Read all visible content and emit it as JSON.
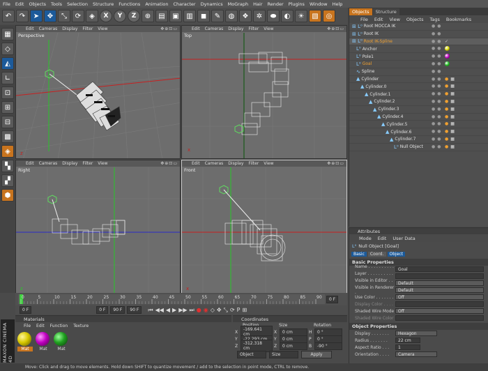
{
  "menubar": [
    "File",
    "Edit",
    "Objects",
    "Tools",
    "Selection",
    "Structure",
    "Functions",
    "Animation",
    "Character",
    "Dynamics",
    "MoGraph",
    "Hair",
    "Render",
    "Plugins",
    "Window",
    "Help"
  ],
  "toolbar": {
    "axis": [
      "X",
      "Y",
      "Z"
    ]
  },
  "viewport_menu": [
    "Edit",
    "Cameras",
    "Display",
    "Filter",
    "View"
  ],
  "viewports": {
    "perspective": "Perspective",
    "top": "Top",
    "right": "Right",
    "front": "Front"
  },
  "timeline": {
    "ticks": [
      "0",
      "5",
      "10",
      "15",
      "20",
      "25",
      "30",
      "35",
      "40",
      "45",
      "50",
      "55",
      "60",
      "65",
      "70",
      "75",
      "80",
      "85",
      "90"
    ],
    "end_field": "0 F"
  },
  "transport": {
    "start": "0 F",
    "mid": "0 F",
    "end": "90 F",
    "end2": "90 F"
  },
  "materials": {
    "title": "Materials",
    "menu": [
      "File",
      "Edit",
      "Function",
      "Texture"
    ],
    "items": [
      {
        "label": "Mat",
        "color": "#d8c800"
      },
      {
        "label": "Mat",
        "color": "#c000c0"
      },
      {
        "label": "Mat",
        "color": "#20a020"
      }
    ]
  },
  "coordinates": {
    "title": "Coordinates",
    "headers": [
      "Position",
      "Size",
      "Rotation"
    ],
    "rows": [
      {
        "axis": "X",
        "pos": "-169.641 cm",
        "saxis": "X",
        "size": "0 cm",
        "raxis": "H",
        "rot": "0 °"
      },
      {
        "axis": "Y",
        "pos": "-22.293 cm",
        "saxis": "Y",
        "size": "0 cm",
        "raxis": "P",
        "rot": "0 °"
      },
      {
        "axis": "Z",
        "pos": "-312.318 cm",
        "saxis": "Z",
        "size": "0 cm",
        "raxis": "B",
        "rot": "-90 °"
      }
    ],
    "mode1": "Object",
    "mode2": "Size",
    "apply": "Apply"
  },
  "status": "Move: Click and drag to move elements. Hold down SHIFT to quantize movement / add to the selection in point mode, CTRL to remove.",
  "brand": "MAXON CINEMA 4D",
  "objects": {
    "tabs": [
      "Objects",
      "Structure"
    ],
    "menu": [
      "File",
      "Edit",
      "View",
      "Objects",
      "Tags",
      "Bookmarks"
    ],
    "rows": [
      {
        "name": "Root MOCCA IK",
        "indent": 0,
        "sel": false
      },
      {
        "name": "Root IK",
        "indent": 0,
        "sel": false
      },
      {
        "name": "Root IK-Spline",
        "indent": 0,
        "sel": true
      },
      {
        "name": "Anchor",
        "indent": 1,
        "sel": false
      },
      {
        "name": "Pole1",
        "indent": 1,
        "sel": false
      },
      {
        "name": "Goal",
        "indent": 1,
        "sel": true
      },
      {
        "name": "Spline",
        "indent": 1,
        "sel": false
      },
      {
        "name": "Cylinder",
        "indent": 1,
        "sel": false
      },
      {
        "name": "Cylinder.0",
        "indent": 2,
        "sel": false
      },
      {
        "name": "Cylinder.1",
        "indent": 3,
        "sel": false
      },
      {
        "name": "Cylinder.2",
        "indent": 4,
        "sel": false
      },
      {
        "name": "Cylinder.3",
        "indent": 5,
        "sel": false
      },
      {
        "name": "Cylinder.4",
        "indent": 6,
        "sel": false
      },
      {
        "name": "Cylinder.5",
        "indent": 7,
        "sel": false
      },
      {
        "name": "Cylinder.6",
        "indent": 8,
        "sel": false
      },
      {
        "name": "Cylinder.7",
        "indent": 9,
        "sel": false
      },
      {
        "name": "Null Object",
        "indent": 10,
        "sel": false
      }
    ]
  },
  "attributes": {
    "title": "Attributes",
    "menu": [
      "Mode",
      "Edit",
      "User Data"
    ],
    "object": "Null Object [Goal]",
    "buttons": [
      "Basic",
      "Coord.",
      "Object"
    ],
    "basic_title": "Basic Properties",
    "basic": [
      {
        "label": "Name . . . . . . . . . . .",
        "value": "Goal",
        "dd": false,
        "dis": false
      },
      {
        "label": "Layer . . . . . . . . . . .",
        "value": "",
        "dd": false,
        "dis": false
      },
      {
        "label": "Visible in Editor . . .",
        "value": "Default",
        "dd": true,
        "dis": false
      },
      {
        "label": "Visible in Renderer .",
        "value": "Default",
        "dd": true,
        "dis": false
      },
      {
        "label": "Use Color . . . . . . .",
        "value": "Off",
        "dd": true,
        "dis": false
      },
      {
        "label": "Display Color . . . .",
        "value": "",
        "dd": false,
        "dis": true
      },
      {
        "label": "Shaded Wire Mode",
        "value": "Off",
        "dd": true,
        "dis": false
      },
      {
        "label": "Shaded Wire Color",
        "value": "",
        "dd": false,
        "dis": true
      }
    ],
    "object_title": "Object Properties",
    "objprops": [
      {
        "label": "Display . . . . . . .",
        "value": "Hexagon"
      },
      {
        "label": "Radius . . . . . . .",
        "value": "22 cm"
      },
      {
        "label": "Aspect Ratio . . .",
        "value": "1"
      },
      {
        "label": "Orientation . . . .",
        "value": "Camera"
      }
    ]
  }
}
